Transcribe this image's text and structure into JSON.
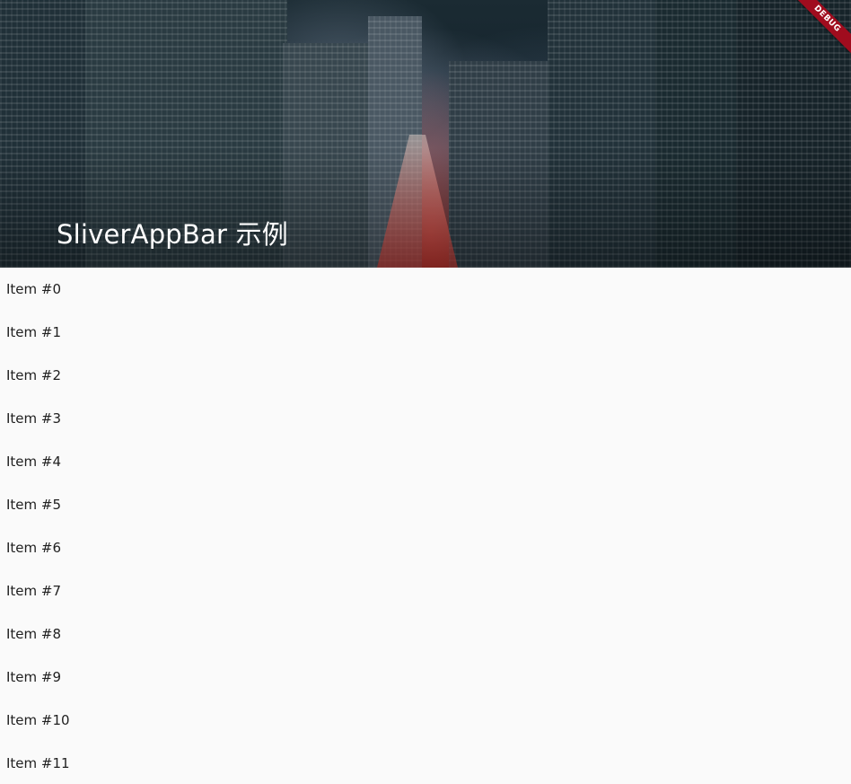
{
  "app_bar": {
    "title": "SliverAppBar 示例",
    "background_image": "night-city-street-photo"
  },
  "debug_banner": {
    "label": "DEBUG",
    "color": "#a00c1e"
  },
  "list": {
    "items": [
      {
        "label": "Item #0"
      },
      {
        "label": "Item #1"
      },
      {
        "label": "Item #2"
      },
      {
        "label": "Item #3"
      },
      {
        "label": "Item #4"
      },
      {
        "label": "Item #5"
      },
      {
        "label": "Item #6"
      },
      {
        "label": "Item #7"
      },
      {
        "label": "Item #8"
      },
      {
        "label": "Item #9"
      },
      {
        "label": "Item #10"
      },
      {
        "label": "Item #11"
      }
    ]
  }
}
